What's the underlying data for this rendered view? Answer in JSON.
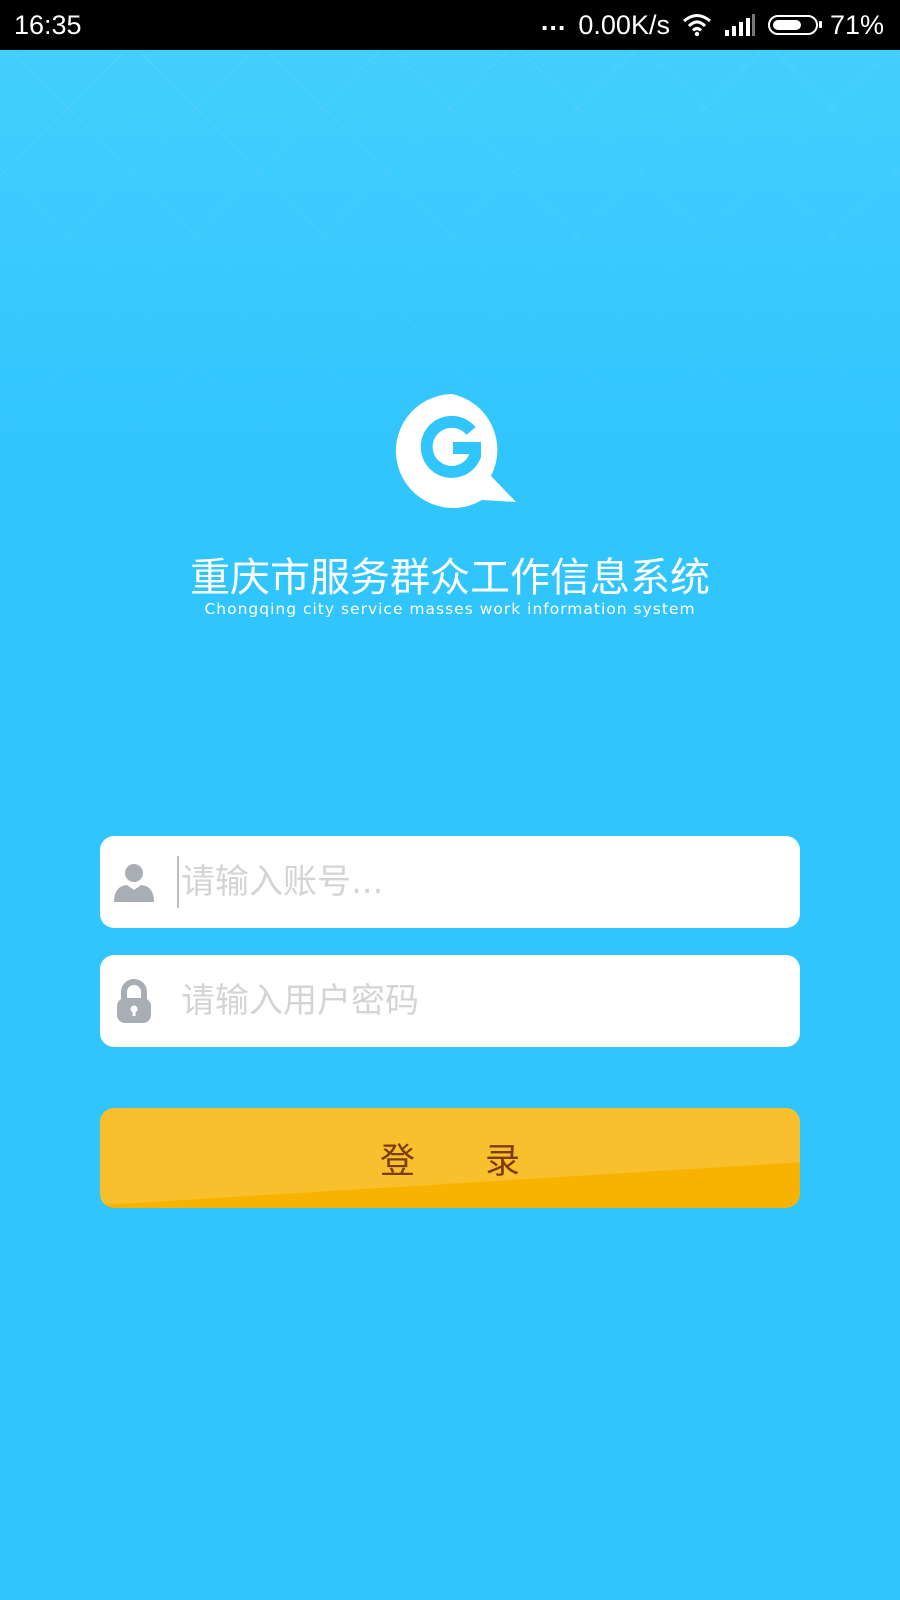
{
  "status_bar": {
    "time": "16:35",
    "dots": "...",
    "net_speed": "0.00K/s",
    "battery_percent": "71%",
    "battery_level": 0.71
  },
  "app": {
    "title": "重庆市服务群众工作信息系统",
    "subtitle": "Chongqing city service masses work information system",
    "logo_icon": "g-speech-bubble-logo"
  },
  "login_form": {
    "account_placeholder": "请输入账号...",
    "password_placeholder": "请输入用户密码",
    "login_button_label": "登　　录"
  },
  "colors": {
    "background": "#31c5fd",
    "button": "#f8b300",
    "button_text": "#7a3d06",
    "icon_gray": "#a9aeb5"
  }
}
